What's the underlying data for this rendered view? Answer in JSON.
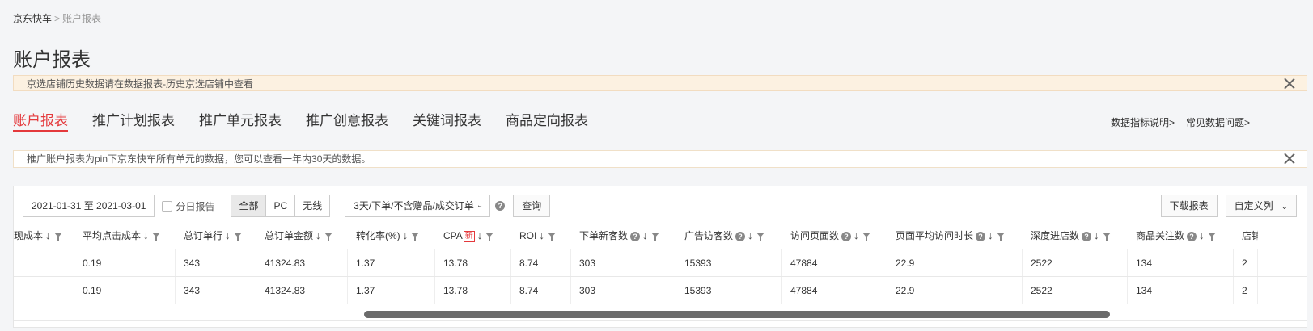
{
  "breadcrumb": {
    "home": "京东快车",
    "separator": ">",
    "current": "账户报表"
  },
  "page_title": "账户报表",
  "notice_warn": "京选店铺历史数据请在数据报表-历史京选店铺中查看",
  "tabs": [
    {
      "label": "账户报表",
      "active": true
    },
    {
      "label": "推广计划报表"
    },
    {
      "label": "推广单元报表"
    },
    {
      "label": "推广创意报表"
    },
    {
      "label": "关键词报表"
    },
    {
      "label": "商品定向报表"
    }
  ],
  "help_links": {
    "metrics": "数据指标说明>",
    "faq": "常见数据问题>"
  },
  "notice_info": "推广账户报表为pin下京东快车所有单元的数据，您可以查看一年内30天的数据。",
  "toolbar": {
    "date_range": "2021-01-31 至 2021-03-01",
    "daily_report_label": "分日报告",
    "device_options": [
      "全部",
      "PC",
      "无线"
    ],
    "device_selected": "全部",
    "attribution_select": "3天/下单/不含赠品/成交订单",
    "query_label": "查询",
    "download_label": "下载报表",
    "custom_columns_label": "自定义列"
  },
  "table": {
    "headers": [
      "现成本",
      "平均点击成本",
      "总订单行",
      "总订单金额",
      "转化率(%)",
      "CPA",
      "ROI",
      "下单新客数",
      "广告访客数",
      "访问页面数",
      "页面平均访问时长",
      "深度进店数",
      "商品关注数",
      "店铺"
    ],
    "new_badge": "新",
    "rows": [
      [
        "",
        "0.19",
        "343",
        "41324.83",
        "1.37",
        "13.78",
        "8.74",
        "303",
        "15393",
        "47884",
        "22.9",
        "2522",
        "134",
        "2"
      ],
      [
        "",
        "0.19",
        "343",
        "41324.83",
        "1.37",
        "13.78",
        "8.74",
        "303",
        "15393",
        "47884",
        "22.9",
        "2522",
        "134",
        "2"
      ]
    ]
  },
  "colors": {
    "accent": "#e4393c",
    "warn_bg": "#fcf1e1",
    "scroll_thumb": "#6b6b6b"
  },
  "icons": {
    "sort": "↓",
    "filter": "filter-icon",
    "help": "?",
    "close": "close-icon",
    "caret": "⌄"
  }
}
